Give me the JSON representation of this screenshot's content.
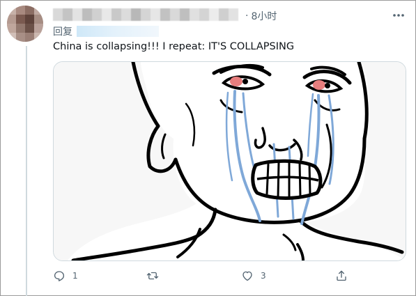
{
  "tweet": {
    "time": "8小时",
    "dot": "·",
    "reply_prefix": "回复",
    "text": "China is collapsing!!! I repeat: IT'S COLLAPSING"
  },
  "actions": {
    "reply_count": "1",
    "retweet_count": "",
    "like_count": "3",
    "share_count": ""
  },
  "media": {
    "alt_icon": "crying-wojak-image"
  },
  "colors": {
    "text": "#0f1419",
    "secondary": "#536471",
    "border": "#cfd9de",
    "tears": "#7fa8d8",
    "eyes": "#e87e7e"
  }
}
